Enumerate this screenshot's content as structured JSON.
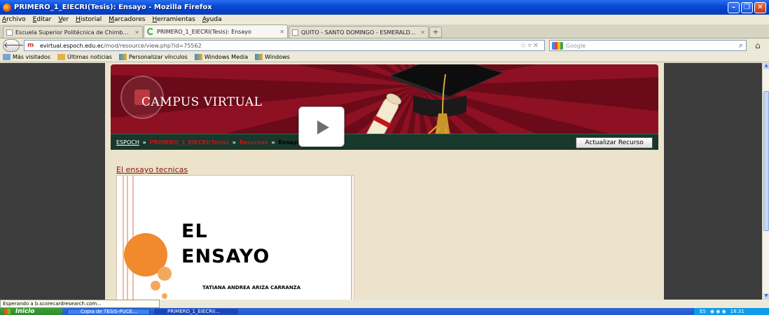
{
  "window": {
    "title": "PRIMERO_1_EIECRI(Tesis): Ensayo - Mozilla Firefox"
  },
  "menu": [
    "Archivo",
    "Editar",
    "Ver",
    "Historial",
    "Marcadores",
    "Herramientas",
    "Ayuda"
  ],
  "tabs": [
    {
      "label": "Escuela Superior Politécnica de Chimborazo",
      "active": false
    },
    {
      "label": "PRIMERO_1_EIECRI(Tesis): Ensayo",
      "active": true
    },
    {
      "label": "QUITO - SANTO DOMINGO - ESMERALDA...",
      "active": false
    }
  ],
  "nav": {
    "url_domain": "evirtual.espoch.edu.ec",
    "url_path": "/mod/resource/view.php?id=75562",
    "search_placeholder": "Google"
  },
  "bookmarks": [
    "Más visitados",
    "Últimas noticias",
    "Personalizar vínculos",
    "Windows Media",
    "Windows"
  ],
  "page": {
    "brand": "CAMPUS VIRTUAL",
    "breadcrumb": {
      "home": "ESPOCH",
      "course": "PRIMERO_1_EIECRI(Tesis)",
      "section": "Recursos",
      "current": "Ensayo",
      "separator": "»"
    },
    "update_button": "Actualizar Recurso",
    "resource_title": "El ensayo tecnicas",
    "document": {
      "line1": "EL",
      "line2": "ENSAYO",
      "author": "TATIANA ANDREA ARIZA CARRANZA"
    }
  },
  "status": {
    "text": "Esperando a b.scorecardresearch.com..."
  },
  "taskbar": {
    "start": "Inicio",
    "items": [
      "Copia de TESIS-PUCE...",
      "PRIMERO_1_EIECRI(..."
    ],
    "tray_lang": "ES",
    "clock": "18:31"
  },
  "colors": {
    "banner_red": "#8d1023",
    "crumb_green": "#17382a",
    "page_bg": "#ebe3cb",
    "link_red": "#8f1010"
  }
}
